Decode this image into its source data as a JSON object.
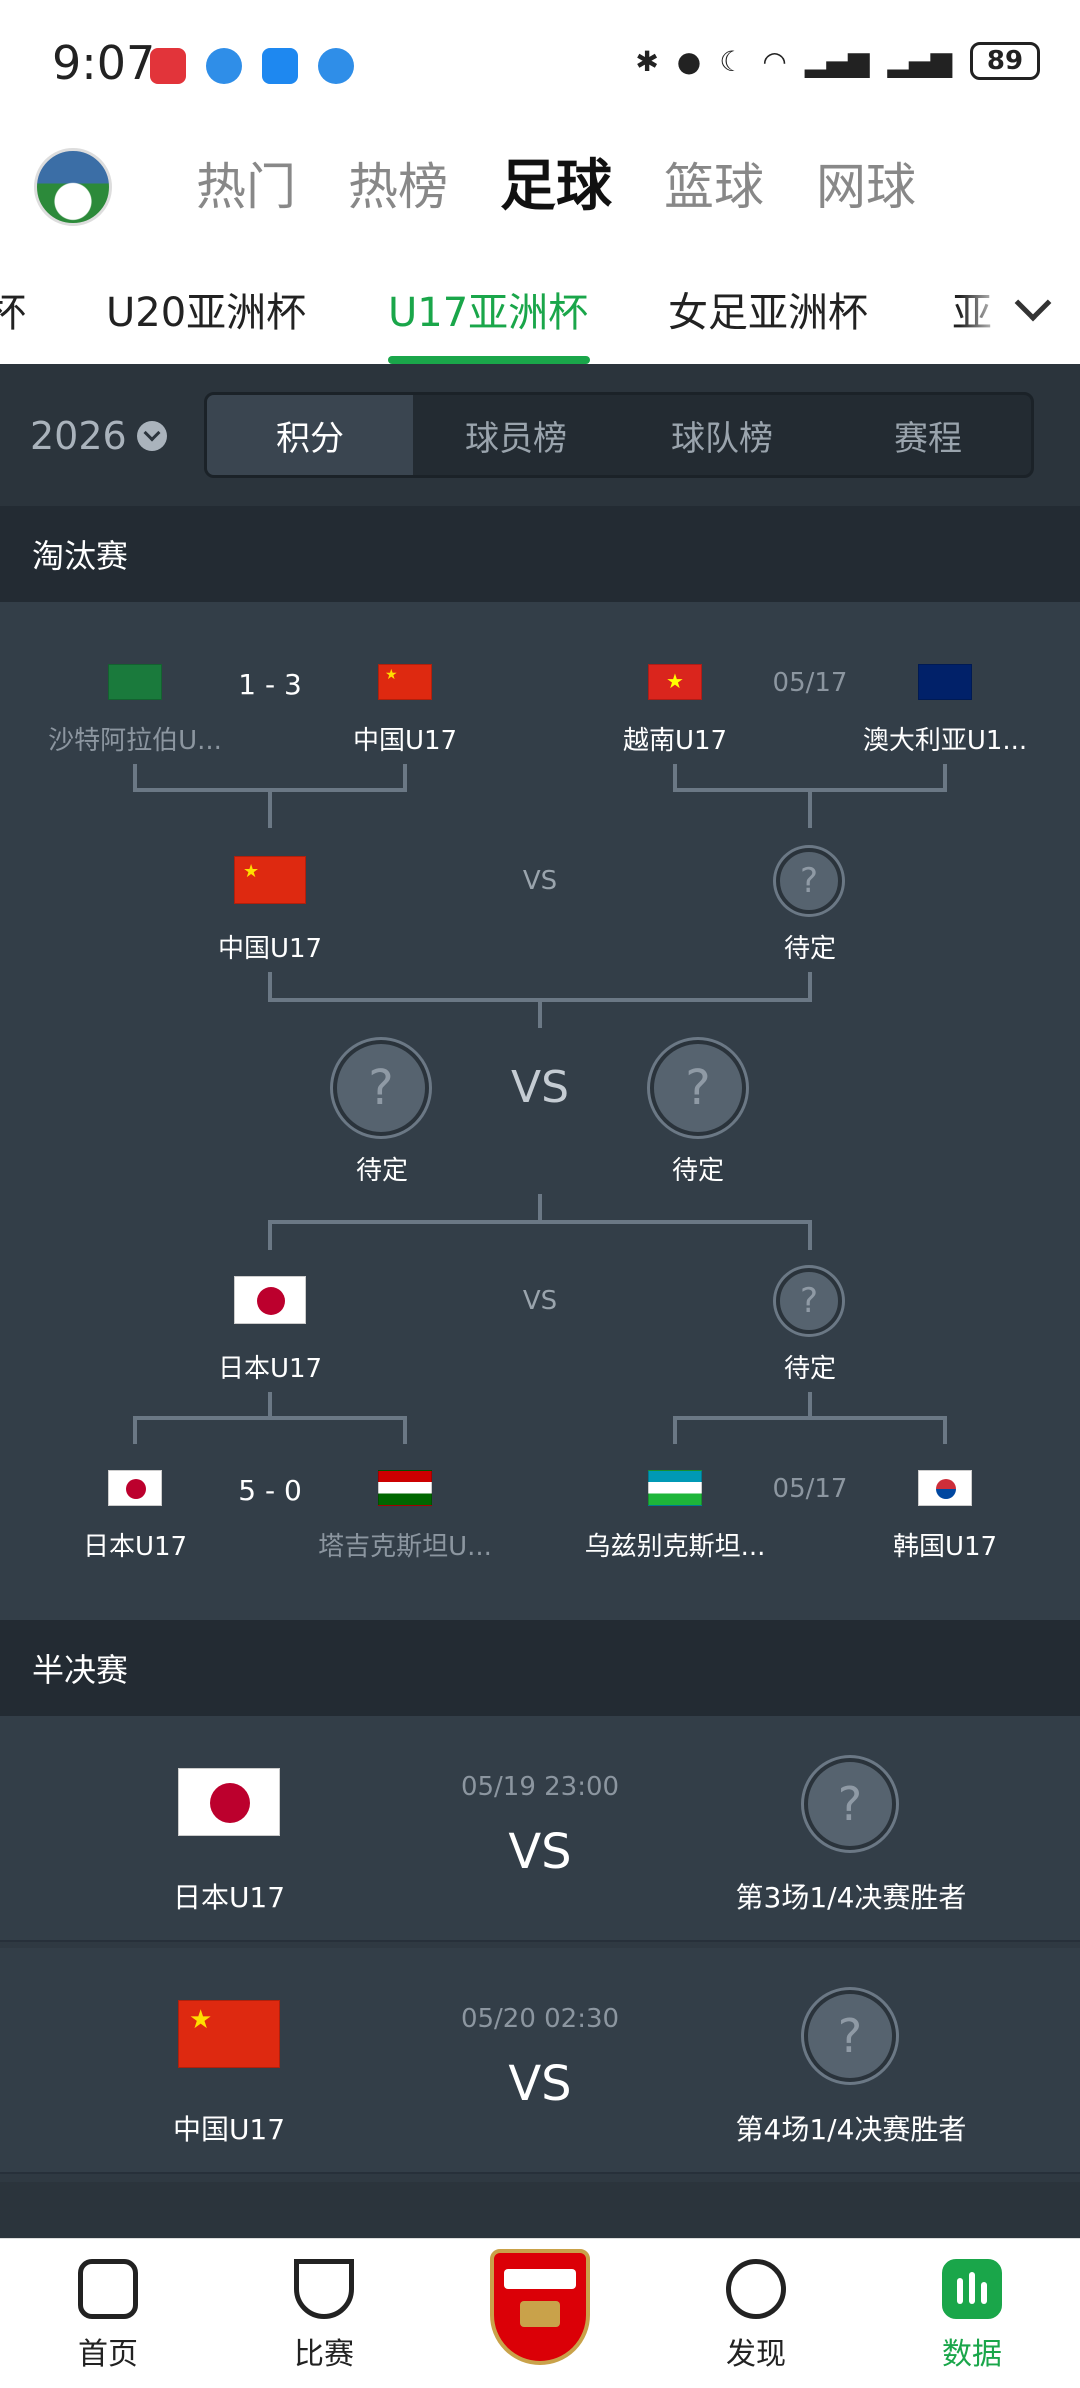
{
  "status_bar": {
    "time": "9:07",
    "battery": "89"
  },
  "top_tabs": [
    "热门",
    "热榜",
    "足球",
    "篮球",
    "网球"
  ],
  "top_active": 2,
  "league_tabs": [
    "杯",
    "U20亚洲杯",
    "U17亚洲杯",
    "女足亚洲杯",
    "亚"
  ],
  "league_active": 2,
  "season": "2026",
  "segments": [
    "积分",
    "球员榜",
    "球队榜",
    "赛程"
  ],
  "segment_active": 0,
  "knockout": {
    "title": "淘汰赛",
    "qf1": {
      "home": "沙特阿拉伯U...",
      "away": "中国U17",
      "score": "1 - 3"
    },
    "qf2": {
      "home": "越南U17",
      "away": "澳大利亚U1...",
      "date": "05/17"
    },
    "qf3": {
      "home": "日本U17",
      "away": "塔吉克斯坦U...",
      "score": "5 - 0"
    },
    "qf4": {
      "home": "乌兹别克斯坦...",
      "away": "韩国U17",
      "date": "05/17"
    },
    "sf1": {
      "home": "中国U17",
      "away": "待定",
      "vs": "VS"
    },
    "sf2": {
      "home": "日本U17",
      "away": "待定",
      "vs": "VS"
    },
    "final": {
      "home": "待定",
      "away": "待定",
      "vs": "VS"
    }
  },
  "semifinal": {
    "title": "半决赛",
    "matches": [
      {
        "home": "日本U17",
        "date": "05/19  23:00",
        "vs": "VS",
        "away": "第3场1/4决赛胜者"
      },
      {
        "home": "中国U17",
        "date": "05/20  02:30",
        "vs": "VS",
        "away": "第4场1/4决赛胜者"
      }
    ]
  },
  "question_mark": "?",
  "bottom_nav": [
    {
      "label": "首页",
      "icon": "home-icon"
    },
    {
      "label": "比赛",
      "icon": "trophy-icon"
    },
    {
      "label": "",
      "icon": "arsenal-crest-icon"
    },
    {
      "label": "发现",
      "icon": "planet-icon"
    },
    {
      "label": "数据",
      "icon": "data-chart-icon"
    }
  ],
  "bottom_active": 4,
  "colors": {
    "accent": "#1aa64a",
    "bg": "#333e48",
    "header_bg": "#232b33"
  }
}
